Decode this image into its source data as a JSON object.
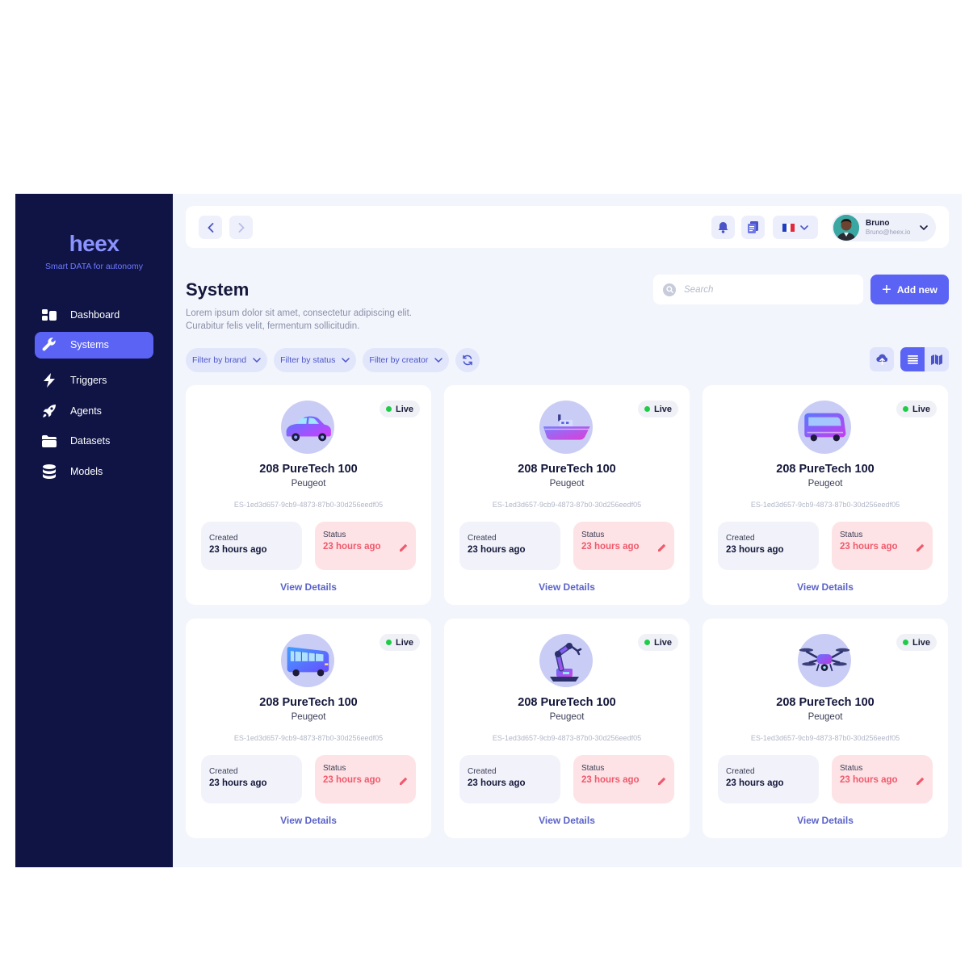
{
  "brand": {
    "name": "heex",
    "tagline": "Smart DATA for autonomy"
  },
  "sidebar": {
    "items": [
      {
        "label": "Dashboard",
        "icon": "dashboard-icon"
      },
      {
        "label": "Systems",
        "icon": "wrench-icon",
        "active": true
      },
      {
        "label": "Triggers",
        "icon": "lightning-icon"
      },
      {
        "label": "Agents",
        "icon": "rocket-icon"
      },
      {
        "label": "Datasets",
        "icon": "folder-icon"
      },
      {
        "label": "Models",
        "icon": "database-icon"
      }
    ]
  },
  "topbar": {
    "user": {
      "name": "Bruno",
      "email": "Bruno@heex.io"
    },
    "language_flag": "fr"
  },
  "page": {
    "title": "System",
    "description_line1": "Lorem ipsum dolor sit amet, consectetur adipiscing elit.",
    "description_line2": "Curabitur felis velit, fermentum sollicitudin.",
    "search_placeholder": "Search",
    "add_label": "Add new"
  },
  "filters": [
    {
      "label": "Filter by brand"
    },
    {
      "label": "Filter by status"
    },
    {
      "label": "Filter by creator"
    }
  ],
  "colors": {
    "sidebar_bg": "#0f1445",
    "accent": "#5b63f5",
    "live": "#1fcc48",
    "status_red": "#f0596b"
  },
  "cards": [
    {
      "image": "car",
      "badge": "Live",
      "name": "208 PureTech 100",
      "brand": "Peugeot",
      "id": "ES-1ed3d657-9cb9-4873-87b0-30d256eedf05",
      "created_label": "Created",
      "created_value": "23 hours ago",
      "status_label": "Status",
      "status_value": "23 hours ago",
      "link": "View Details"
    },
    {
      "image": "boat",
      "badge": "Live",
      "name": "208 PureTech 100",
      "brand": "Peugeot",
      "id": "ES-1ed3d657-9cb9-4873-87b0-30d256eedf05",
      "created_label": "Created",
      "created_value": "23 hours ago",
      "status_label": "Status",
      "status_value": "23 hours ago",
      "link": "View Details"
    },
    {
      "image": "shuttle",
      "badge": "Live",
      "name": "208 PureTech 100",
      "brand": "Peugeot",
      "id": "ES-1ed3d657-9cb9-4873-87b0-30d256eedf05",
      "created_label": "Created",
      "created_value": "23 hours ago",
      "status_label": "Status",
      "status_value": "23 hours ago",
      "link": "View Details"
    },
    {
      "image": "bus",
      "badge": "Live",
      "name": "208 PureTech 100",
      "brand": "Peugeot",
      "id": "ES-1ed3d657-9cb9-4873-87b0-30d256eedf05",
      "created_label": "Created",
      "created_value": "23 hours ago",
      "status_label": "Status",
      "status_value": "23 hours ago",
      "link": "View Details"
    },
    {
      "image": "robot-arm",
      "badge": "Live",
      "name": "208 PureTech 100",
      "brand": "Peugeot",
      "id": "ES-1ed3d657-9cb9-4873-87b0-30d256eedf05",
      "created_label": "Created",
      "created_value": "23 hours ago",
      "status_label": "Status",
      "status_value": "23 hours ago",
      "link": "View Details"
    },
    {
      "image": "drone",
      "badge": "Live",
      "name": "208 PureTech 100",
      "brand": "Peugeot",
      "id": "ES-1ed3d657-9cb9-4873-87b0-30d256eedf05",
      "created_label": "Created",
      "created_value": "23 hours ago",
      "status_label": "Status",
      "status_value": "23 hours ago",
      "link": "View Details"
    }
  ]
}
